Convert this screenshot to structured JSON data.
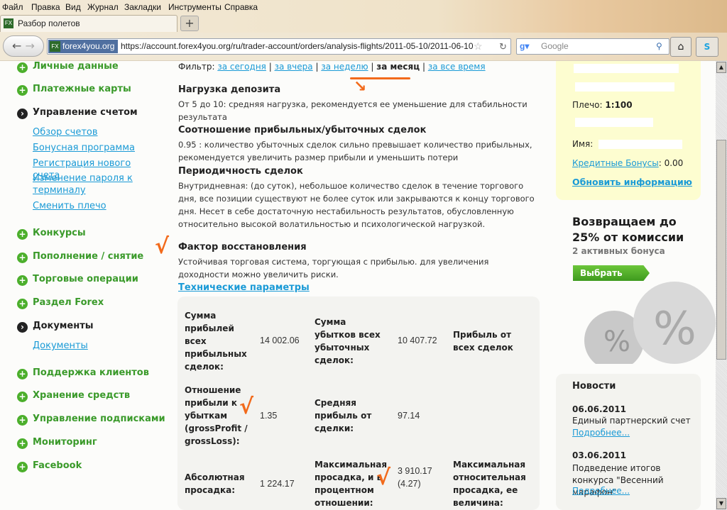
{
  "browser": {
    "menu": [
      "Файл",
      "Правка",
      "Вид",
      "Журнал",
      "Закладки",
      "Инструменты",
      "Справка"
    ],
    "tab_title": "Разбор полетов",
    "site_badge": "forex4you.org",
    "url": "https://account.forex4you.org/ru/trader-account/orders/analysis-flights/2011-05-10/2011-06-10",
    "search_placeholder": "Google"
  },
  "sidebar": {
    "items": [
      {
        "label": "Личные данные"
      },
      {
        "label": "Платежные карты"
      },
      {
        "label": "Управление счетом"
      },
      {
        "label": "Конкурсы"
      },
      {
        "label": "Пополнение / снятие"
      },
      {
        "label": "Торговые операции"
      },
      {
        "label": "Раздел Forex"
      },
      {
        "label": "Документы"
      },
      {
        "label": "Поддержка клиентов"
      },
      {
        "label": "Хранение средств"
      },
      {
        "label": "Управление подписками"
      },
      {
        "label": "Мониторинг"
      },
      {
        "label": "Facebook"
      }
    ],
    "account_sub": [
      "Обзор счетов",
      "Бонусная программа",
      "Регистрация нового счета",
      "Изменение пароля к терминалу",
      "Сменить плечо"
    ],
    "docs_sub": [
      "Документы"
    ]
  },
  "filter": {
    "label": "Фильтр",
    "options": [
      "за сегодня",
      "за вчера",
      "за неделю",
      "за месяц",
      "за все время"
    ],
    "active": "за месяц"
  },
  "sections": [
    {
      "title": "Нагрузка депозита",
      "text": "От 5 до 10: средняя нагрузка, рекомендуется ее уменьшение для стабильности результата"
    },
    {
      "title": "Соотношение прибыльных/убыточных сделок",
      "text": "0.95 : количество убыточных сделок сильно превышает количество прибыльных, рекомендуется увеличить размер прибыли и уменьшить потери"
    },
    {
      "title": "Периодичность сделок",
      "text": "Внутридневная: (до суток), небольшое количество сделок в течение торгового дня, все позиции существуют не более суток или закрываются к концу торгового дня. Несет в себе достаточную нестабильность результатов, обусловленную относительно высокой волатильностью и психологической нагрузкой."
    },
    {
      "title": "Фактор восстановления",
      "text": "Устойчивая торговая система, торгующая с прибылью. для увеличения доходности можно увеличить риски."
    }
  ],
  "tech_link": "Технические параметры",
  "params": [
    {
      "label": "Сумма прибылей всех прибыльных сделок:",
      "value": "14 002.06"
    },
    {
      "label": "Сумма убытков всех убыточных сделок:",
      "value": "10 407.72"
    },
    {
      "label": "Прибыль от всех сделок",
      "value": ""
    },
    {
      "label": "Отношение прибыли к убыткам (grossProfit / grossLoss):",
      "value": "1.35"
    },
    {
      "label": "Средняя прибыль от сделки:",
      "value": "97.14"
    },
    {
      "label": "Абсолютная просадка:",
      "value": "1 224.17"
    },
    {
      "label": "Максимальная просадка, и в процентном отношении:",
      "value": "3 910.17 (4.27)"
    },
    {
      "label": "Максимальная относительная просадка, ее величина:",
      "value": ""
    }
  ],
  "account": {
    "leverage_label": "Плечо:",
    "leverage": "1:100",
    "name_label": "Имя:",
    "credit_label": "Кредитные Бонусы",
    "credit_value": ": 0.00",
    "refresh": "Обновить информацию"
  },
  "promo": {
    "title": "Возвращаем до 25% от комиссии",
    "subtitle": "2 активных бонуса",
    "button": "Выбрать бонус"
  },
  "news": {
    "title": "Новости",
    "items": [
      {
        "date": "06.06.2011",
        "text": "Единый партнерский счет",
        "more": "Подробнее..."
      },
      {
        "date": "03.06.2011",
        "text": "Подведение итогов конкурса \"Весенний марафон\"",
        "more": "Подробнее..."
      }
    ]
  }
}
